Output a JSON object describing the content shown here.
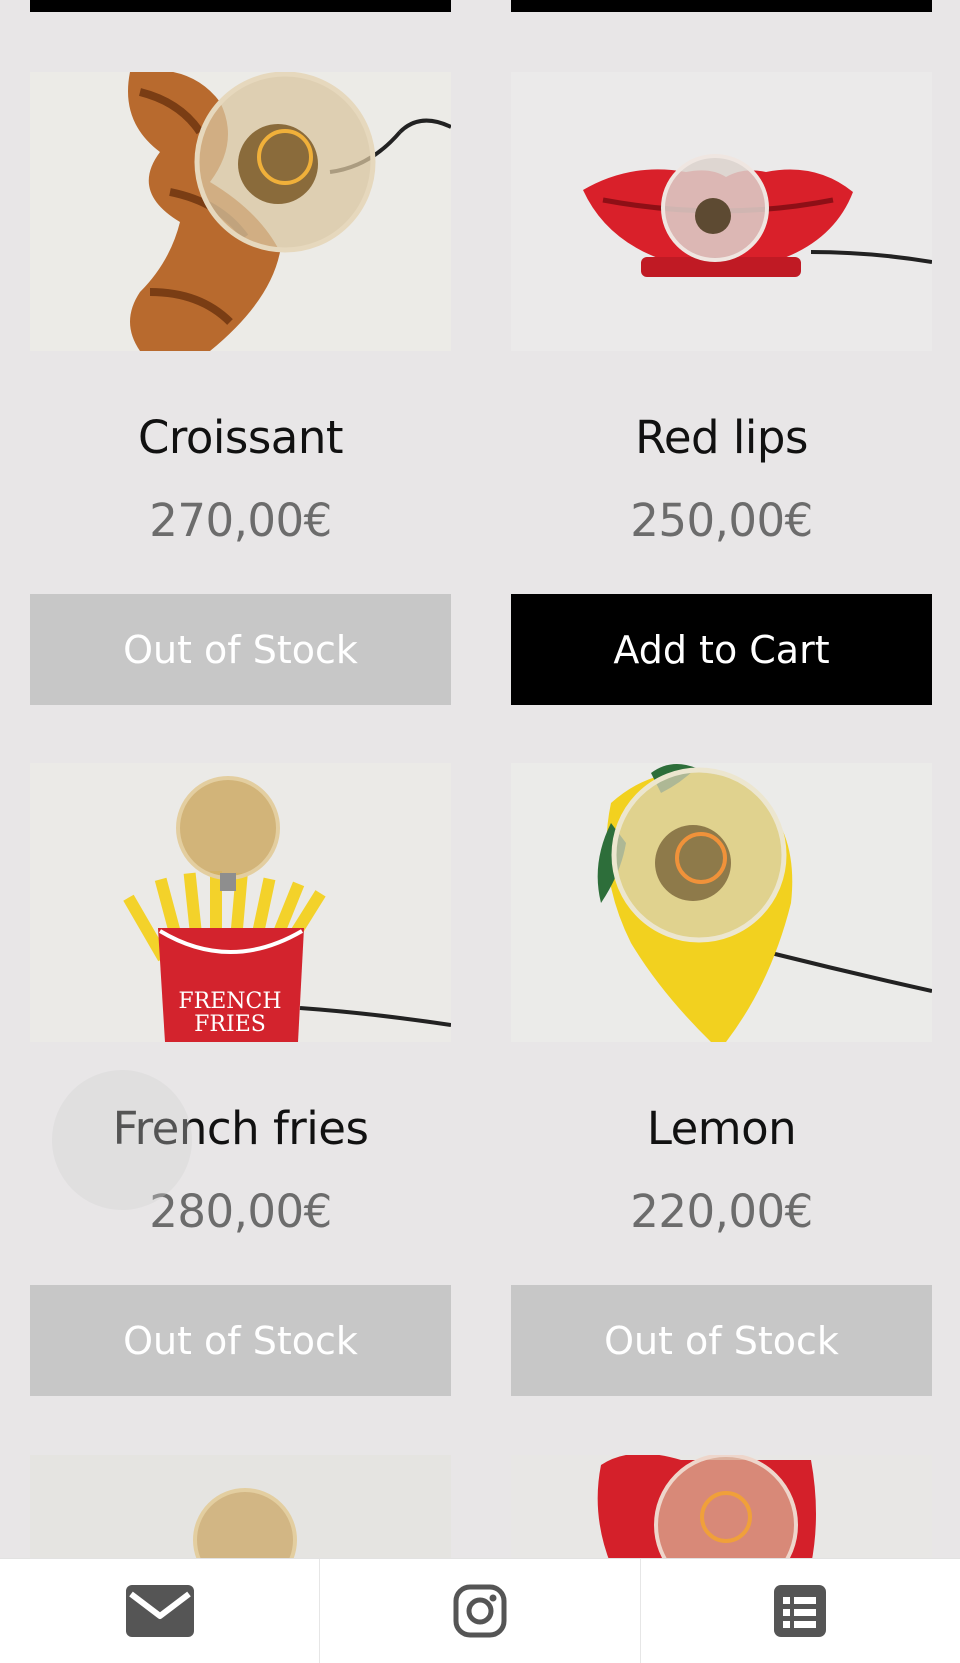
{
  "products": [
    {
      "name": "Croissant",
      "price": "270,00€",
      "button": "Out of Stock",
      "in_stock": false
    },
    {
      "name": "Red lips",
      "price": "250,00€",
      "button": "Add to Cart",
      "in_stock": true
    },
    {
      "name": "French fries",
      "price": "280,00€",
      "button": "Out of Stock",
      "in_stock": false,
      "image_text": "FRENCH FRIES"
    },
    {
      "name": "Lemon",
      "price": "220,00€",
      "button": "Out of Stock",
      "in_stock": false
    }
  ],
  "bottom_nav": {
    "icons": [
      "mail-icon",
      "instagram-icon",
      "menu-list-icon"
    ]
  },
  "colors": {
    "background": "#e8e6e7",
    "add_to_cart": "#000000",
    "out_of_stock": "#c7c7c7",
    "price_text": "#6c6c6c",
    "nav_icon": "#555555"
  }
}
